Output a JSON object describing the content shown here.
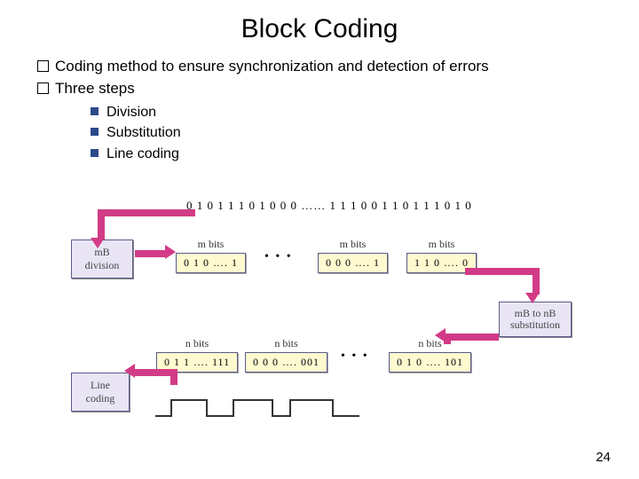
{
  "title": "Block Coding",
  "bullets": {
    "b1": "Coding method to ensure synchronization and detection of errors",
    "b2": "Three steps",
    "sub1": "Division",
    "sub2": "Substitution",
    "sub3": "Line coding"
  },
  "diagram": {
    "bitstream": "0 1 0 1 1 1 0 1 0 0 0 …… 1 1 1 0 0 1 1 0 1 1 1 0 1 0",
    "boxes": {
      "mbdiv": "mB\ndivision",
      "sub": "mB to nB\nsubstitution",
      "line": "Line\ncoding"
    },
    "m_groups": {
      "label": "m bits",
      "g1": "0 1 0 …. 1",
      "g2": "0 0 0 …. 1",
      "g3": "1 1 0 …. 0"
    },
    "n_groups": {
      "label": "n bits",
      "g1": "0 1 1 …. 111",
      "g2": "0 0 0 …. 001",
      "g3": "0 1 0 …. 101"
    },
    "dots": "• • •"
  },
  "page_number": "24"
}
